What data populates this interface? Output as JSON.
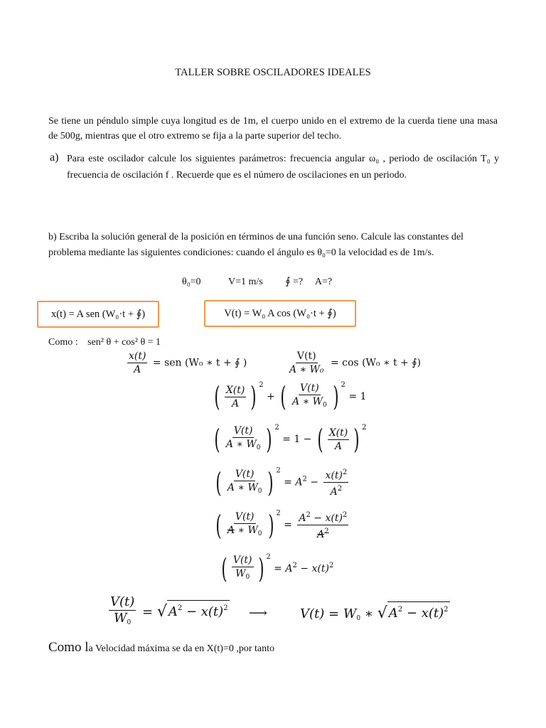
{
  "document": {
    "title": "TALLER SOBRE OSCILADORES IDEALES",
    "intro": "Se tiene un péndulo simple cuya longitud es de 1m, el cuerpo unido en el extremo de la cuerda tiene una masa de 500g, mientras que el otro extremo se fija a la parte superior del techo.",
    "part_a": {
      "label": "a)",
      "text": "Para este oscilador calcule los siguientes parámetros: frecuencia angular ω₀ , periodo de oscilación T₀ y frecuencia de oscilación f . Recuerde que es el número de oscilaciones en un periodo."
    },
    "part_b": {
      "text": "b) Escriba la solución general de la posición en términos de una función seno. Calcule las constantes del problema mediante las siguientes condiciones: cuando el ángulo es θ₀=0 la velocidad es de 1m/s."
    },
    "conditions": {
      "theta": "θ₀=0",
      "velocity": "V=1 m/s",
      "phase": "∮ =?",
      "amplitude": "A=?"
    },
    "boxed_equations": {
      "position": "x(t) = A sen (W₀·t + ∮)",
      "velocity": "V(t) = W₀ A cos (W₀·t + ∮)"
    },
    "identity": {
      "prefix": "Como :",
      "formula": "sen² θ + cos² θ = 1"
    },
    "derivation": {
      "eq1_left": {
        "num": "x(t)",
        "den": "A",
        "rhs": "= sen (W₀ ∗ t + ∮ )"
      },
      "eq1_right": {
        "num": "V(t)",
        "den": "A ∗ W₀",
        "rhs": "= cos (W₀ ∗ t + ∮)"
      },
      "eq2": "(X(t)/A)² + (V(t)/(A ∗ W₀))² = 1",
      "eq3": "(V(t)/(A ∗ W₀))² = 1 − (X(t)/A)²",
      "eq4": "(V(t)/(A ∗ W₀))² = A² − x(t)²/A²",
      "eq5": "(V(t)/(A ∗ W₀))² = (A² − x(t)²)/A²",
      "eq6": "(V(t)/W₀)² = A² − x(t)²",
      "eq7_left": "V(t)/W₀ = √(A² − x(t)²)",
      "arrow": "⟶",
      "eq7_right": "V(t) = W₀ ∗ √(A² − x(t)²)"
    },
    "conclusion": {
      "lead": "Como l",
      "lead2": "a",
      "text": " Velocidad máxima se da en  X(t)=0  ,por tanto"
    }
  }
}
